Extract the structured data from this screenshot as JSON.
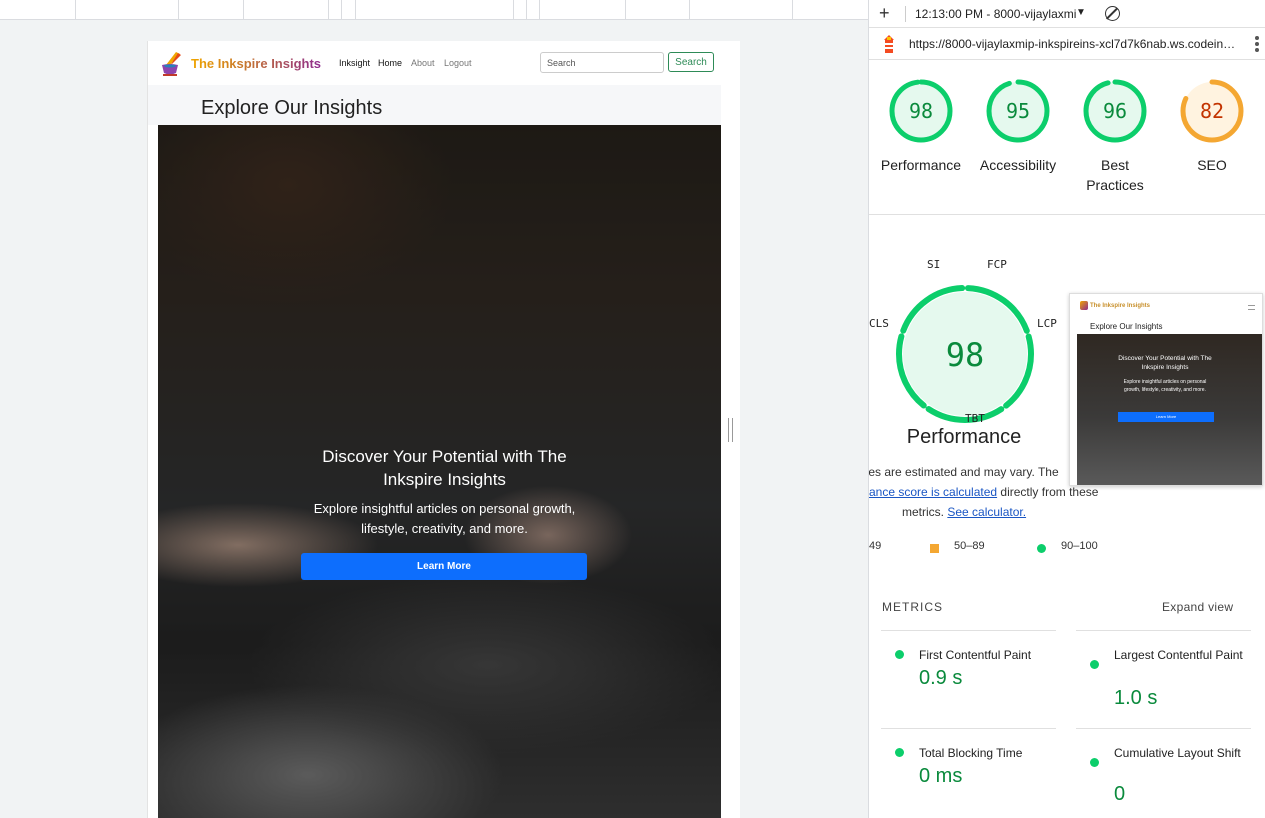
{
  "site": {
    "brand": "The Inkspire Insights",
    "nav": [
      "Inksight",
      "Home",
      "About",
      "Logout"
    ],
    "search_placeholder": "Search",
    "search_button": "Search",
    "heading": "Explore Our Insights",
    "hero": {
      "title": "Discover Your Potential with The Inkspire Insights",
      "subtitle": "Explore insightful articles on personal growth, lifestyle, creativity, and more.",
      "button": "Learn More"
    }
  },
  "devtools": {
    "report_label": "12:13:00 PM - 8000-vijaylaxmi",
    "url": "https://8000-vijaylaxmip-inkspireins-xcl7d7k6nab.ws.codein…",
    "gauges": [
      {
        "label": "Performance",
        "score": "98",
        "value": 98,
        "status": "pass"
      },
      {
        "label": "Accessibility",
        "score": "95",
        "value": 95,
        "status": "pass"
      },
      {
        "label": "Best Practices",
        "score": "96",
        "value": 96,
        "status": "pass"
      },
      {
        "label": "SEO",
        "score": "82",
        "value": 82,
        "status": "average"
      }
    ],
    "performance": {
      "score": "98",
      "title": "Performance",
      "metric_abbrs": [
        "SI",
        "FCP",
        "LCP",
        "TBT",
        "CLS"
      ],
      "desc_line1": "lues are estimated and may vary. The",
      "desc_link1": "ance score is calculated",
      "desc_line2_rest": " directly from these",
      "desc_line3": "metrics.",
      "desc_link2": "See calculator."
    },
    "thumbnail": {
      "brand": "The Inkspire Insights",
      "heading": "Explore Our Insights",
      "title": "Discover Your Potential with The Inkspire Insights",
      "subtitle": "Explore insightful articles on personal growth, lifestyle, creativity, and more.",
      "button": "Learn More"
    },
    "legend": {
      "fail": "49",
      "average": "50–89",
      "pass": "90–100"
    },
    "metrics_header": "METRICS",
    "expand_view": "Expand view",
    "metrics": [
      {
        "name": "First Contentful Paint",
        "value": "0.9 s"
      },
      {
        "name": "Largest Contentful Paint",
        "value": "1.0 s"
      },
      {
        "name": "Total Blocking Time",
        "value": "0 ms"
      },
      {
        "name": "Cumulative Layout Shift",
        "value": "0"
      }
    ]
  },
  "colors": {
    "pass": "#0cce6b",
    "pass_text": "#0a8a3c",
    "average": "#f4a732",
    "average_text": "#c33300",
    "primary_button": "#0d6efd"
  }
}
